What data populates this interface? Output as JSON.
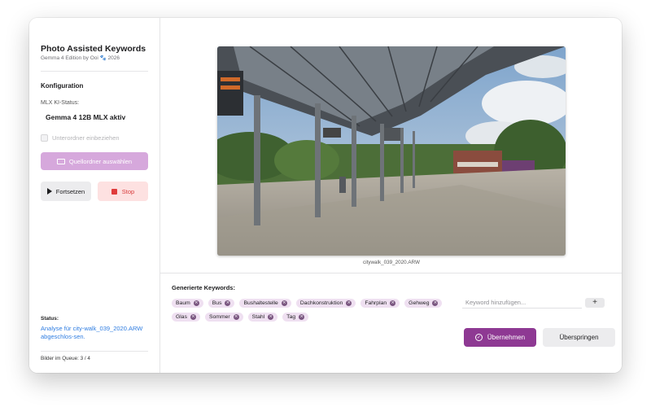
{
  "app": {
    "title": "Photo Assisted Keywords",
    "subtitle": "Gemma 4 Edition by Ooi 🐾 2026"
  },
  "config": {
    "section_title": "Konfiguration",
    "mlx_label": "MLX KI-Status:",
    "mlx_value": "Gemma 4 12B MLX aktiv",
    "subfolder_label": "Unterordner einbeziehen",
    "subfolder_checked": false,
    "folder_button": "Quellordner auswählen",
    "continue_button": "Fortsetzen",
    "stop_button": "Stop"
  },
  "status": {
    "label": "Status:",
    "text": "Analyse für city-walk_039_2020.ARW abgeschlos-sen.",
    "queue": "Bilder im Queue: 3 / 4"
  },
  "image": {
    "filename": "citywalk_039_2020.ARW"
  },
  "keywords": {
    "title": "Generierte Keywords:",
    "items": [
      "Baum",
      "Bus",
      "Bushaltestelle",
      "Dachkonstruktion",
      "Fahrplan",
      "Gehweg",
      "Glas",
      "Sommer",
      "Stahl",
      "Tag"
    ],
    "input_placeholder": "Keyword hinzufügen...",
    "add_button": "+",
    "remove_glyph": "×"
  },
  "actions": {
    "apply_button": "Übernehmen",
    "skip_button": "Überspringen"
  },
  "colors": {
    "accent": "#8e3993",
    "chip_bg": "#efe0f1",
    "status_link": "#2f7de1",
    "stop_red": "#e03c3c"
  }
}
